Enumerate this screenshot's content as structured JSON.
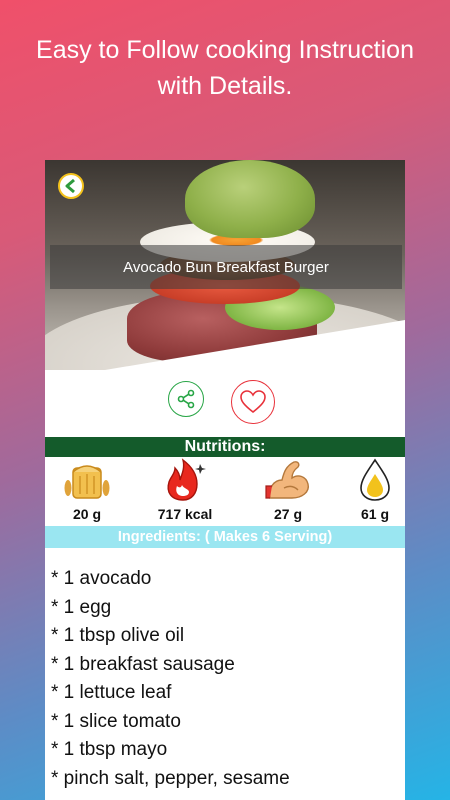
{
  "promo": {
    "line1": "Easy to Follow cooking Instruction",
    "line2": "with Details."
  },
  "recipe": {
    "title": "Avocado Bun Breakfast Burger"
  },
  "nutrition": {
    "heading": "Nutritions:",
    "items": [
      {
        "icon": "grain-icon",
        "value": "20 g"
      },
      {
        "icon": "fire-icon",
        "value": "717 kcal"
      },
      {
        "icon": "muscle-icon",
        "value": "27 g"
      },
      {
        "icon": "oil-drop-icon",
        "value": "61 g"
      }
    ]
  },
  "ingredients": {
    "heading": "Ingredients: ( Makes 6 Serving)",
    "items": [
      "* 1 avocado",
      "* 1 egg",
      "* 1 tbsp olive oil",
      "* 1 breakfast sausage",
      "* 1 lettuce leaf",
      "* 1 slice tomato",
      "* 1 tbsp mayo",
      "* pinch salt, pepper, sesame"
    ]
  },
  "colors": {
    "nutrition_header": "#145b2b",
    "ingredients_header": "#9ae6f1",
    "share_green": "#27a545",
    "favorite_red": "#e8313a",
    "back_yellow": "#f4c21c"
  }
}
